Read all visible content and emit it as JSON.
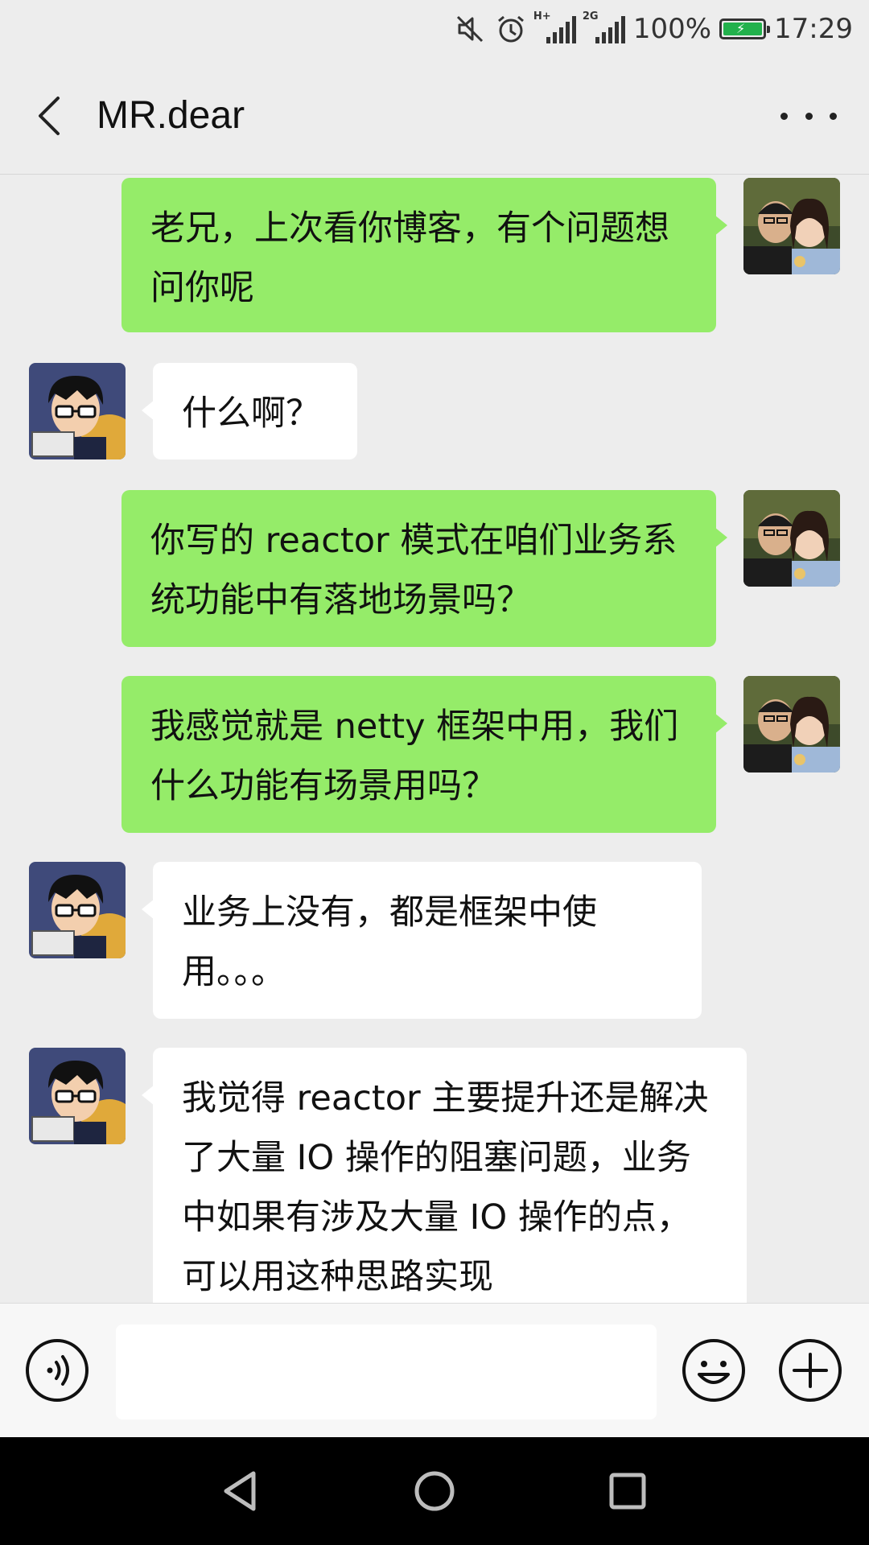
{
  "status_bar": {
    "time": "17:29",
    "battery": "100%",
    "network1": "H+",
    "network2": "2G",
    "icons": [
      "mute-icon",
      "alarm-icon",
      "signal-icon",
      "signal-icon",
      "battery-icon"
    ]
  },
  "header": {
    "title": "MR.dear",
    "back_icon": "chevron-left-icon",
    "more_icon": "more-icon"
  },
  "messages": [
    {
      "side": "sent",
      "sender": "me",
      "text": "老兄，上次看你博客，有个问题想问你呢"
    },
    {
      "side": "received",
      "sender": "MR.dear",
      "text": "什么啊？"
    },
    {
      "side": "sent",
      "sender": "me",
      "text": "你写的 reactor 模式在咱们业务系统功能中有落地场景吗？"
    },
    {
      "side": "sent",
      "sender": "me",
      "text": "我感觉就是 netty 框架中用，我们什么功能有场景用吗？"
    },
    {
      "side": "received",
      "sender": "MR.dear",
      "text": "业务上没有，都是框架中使用。。。"
    },
    {
      "side": "received",
      "sender": "MR.dear",
      "text": "我觉得 reactor 主要提升还是解决了大量 IO 操作的阻塞问题，业务中如果有涉及大量 IO 操作的点，可以用这种思路实现"
    }
  ],
  "input_bar": {
    "voice_icon": "voice-icon",
    "emoji_icon": "emoji-icon",
    "plus_icon": "plus-icon",
    "placeholder": ""
  },
  "colors": {
    "sent_bubble": "#95ec69",
    "received_bubble": "#ffffff",
    "background": "#ededed"
  }
}
